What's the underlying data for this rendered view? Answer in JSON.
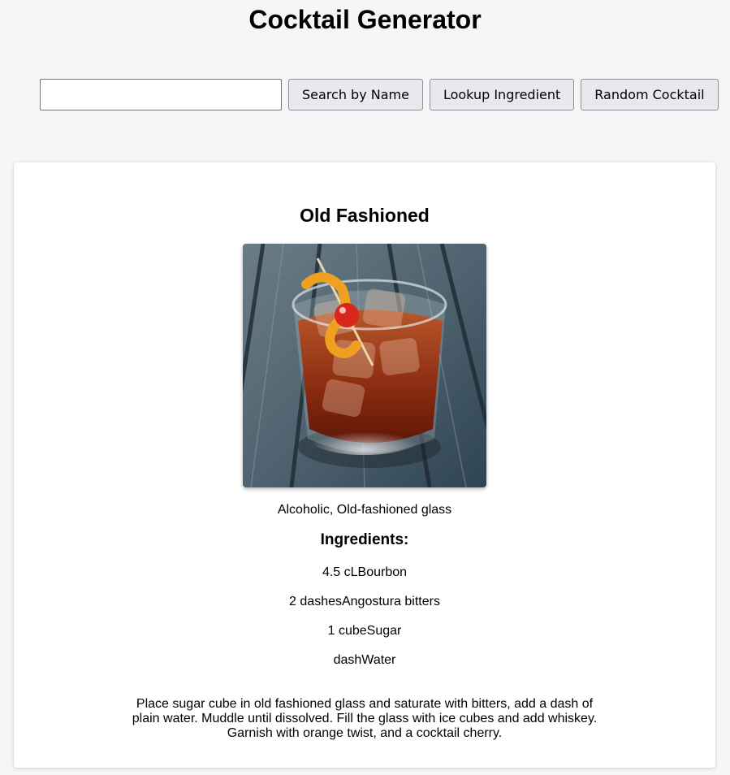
{
  "app": {
    "title": "Cocktail Generator"
  },
  "search": {
    "value": "",
    "placeholder": "",
    "buttons": {
      "search_by_name": "Search by Name",
      "lookup_ingredient": "Lookup Ingredient",
      "random_cocktail": "Random Cocktail"
    }
  },
  "cocktail": {
    "name": "Old Fashioned",
    "image_alt": "Old Fashioned",
    "meta": "Alcoholic, Old-fashioned glass",
    "ingredients_heading": "Ingredients:",
    "ingredients": [
      "4.5 cLBourbon",
      "2 dashesAngostura bitters",
      "1 cubeSugar",
      "dashWater"
    ],
    "instructions": "Place sugar cube in old fashioned glass and saturate with bitters, add a dash of plain water. Muddle until dissolved. Fill the glass with ice cubes and add whiskey. Garnish with orange twist, and a cocktail cherry."
  },
  "colors": {
    "page_background": "#f5f6f8",
    "card_background": "#ffffff",
    "button_background": "#e9e9ed"
  }
}
